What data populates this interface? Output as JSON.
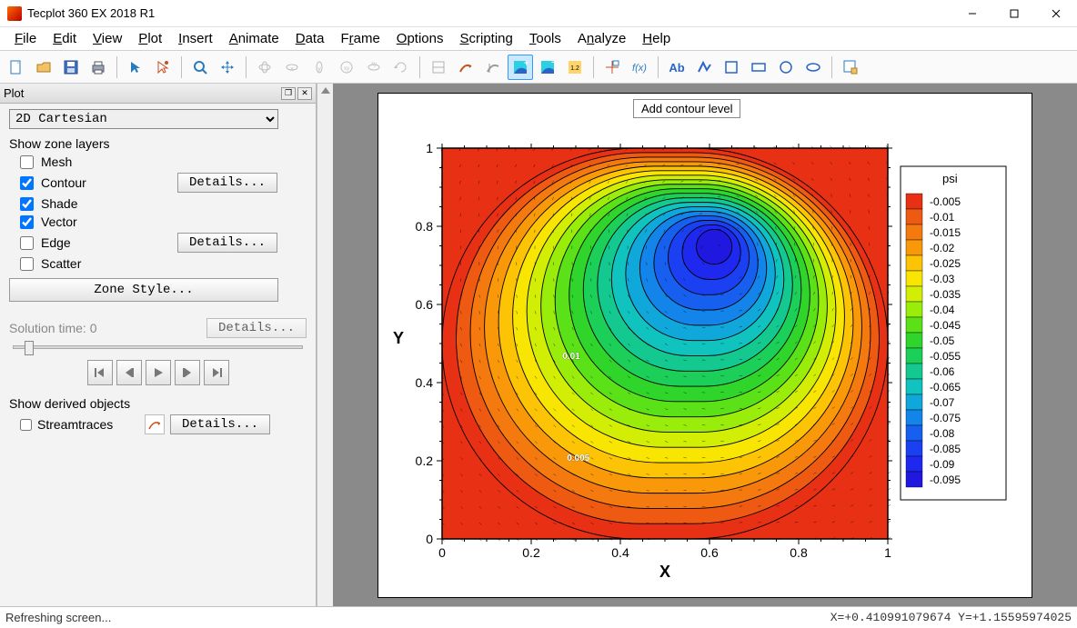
{
  "title": "Tecplot 360 EX 2018 R1",
  "menu": [
    "File",
    "Edit",
    "View",
    "Plot",
    "Insert",
    "Animate",
    "Data",
    "Frame",
    "Options",
    "Scripting",
    "Tools",
    "Analyze",
    "Help"
  ],
  "panel": {
    "title": "Plot",
    "plot_type": "2D Cartesian",
    "show_zone_layers": "Show zone layers",
    "layers": {
      "mesh": {
        "label": "Mesh",
        "checked": false
      },
      "contour": {
        "label": "Contour",
        "checked": true,
        "details": "Details..."
      },
      "shade": {
        "label": "Shade",
        "checked": true
      },
      "vector": {
        "label": "Vector",
        "checked": true
      },
      "edge": {
        "label": "Edge",
        "checked": false,
        "details": "Details..."
      },
      "scatter": {
        "label": "Scatter",
        "checked": false
      }
    },
    "zone_style": "Zone Style...",
    "solution_time_label": "Solution time:",
    "solution_time_value": "0",
    "solution_details": "Details...",
    "derived_title": "Show derived objects",
    "streamtraces": {
      "label": "Streamtraces",
      "checked": false,
      "details": "Details..."
    }
  },
  "tooltip": "Add contour level",
  "status": {
    "left": "Refreshing screen...",
    "right": "X=+0.410991079674  Y=+1.15595974025"
  },
  "chart_data": {
    "type": "contour",
    "variable": "psi",
    "xlabel": "X",
    "ylabel": "Y",
    "xlim": [
      0,
      1
    ],
    "ylim": [
      0,
      1
    ],
    "xticks": [
      0,
      0.2,
      0.4,
      0.6,
      0.8,
      1
    ],
    "yticks": [
      0,
      0.2,
      0.4,
      0.6,
      0.8,
      1
    ],
    "levels": [
      -0.005,
      -0.01,
      -0.015,
      -0.02,
      -0.025,
      -0.03,
      -0.035,
      -0.04,
      -0.045,
      -0.05,
      -0.055,
      -0.06,
      -0.065,
      -0.07,
      -0.075,
      -0.08,
      -0.085,
      -0.09,
      -0.095
    ],
    "center_approx": {
      "x": 0.62,
      "y": 0.74
    },
    "level_colormap": [
      {
        "level": -0.005,
        "color": "#e83015"
      },
      {
        "level": -0.01,
        "color": "#ef5a13"
      },
      {
        "level": -0.015,
        "color": "#f47a0f"
      },
      {
        "level": -0.02,
        "color": "#f9990a"
      },
      {
        "level": -0.025,
        "color": "#fdc405"
      },
      {
        "level": -0.03,
        "color": "#f8e602"
      },
      {
        "level": -0.035,
        "color": "#d2ee04"
      },
      {
        "level": -0.04,
        "color": "#9aec0b"
      },
      {
        "level": -0.045,
        "color": "#5be117"
      },
      {
        "level": -0.05,
        "color": "#2fd52b"
      },
      {
        "level": -0.055,
        "color": "#1ccf59"
      },
      {
        "level": -0.06,
        "color": "#14c98f"
      },
      {
        "level": -0.065,
        "color": "#10c3bf"
      },
      {
        "level": -0.07,
        "color": "#10a7db"
      },
      {
        "level": -0.075,
        "color": "#1384e9"
      },
      {
        "level": -0.08,
        "color": "#1760ef"
      },
      {
        "level": -0.085,
        "color": "#1b40f2"
      },
      {
        "level": -0.09,
        "color": "#1e28ef"
      },
      {
        "level": -0.095,
        "color": "#2118e0"
      }
    ],
    "annotations": [
      {
        "text": "0.01",
        "x": 0.27,
        "y": 0.46
      },
      {
        "text": "0.005",
        "x": 0.28,
        "y": 0.2
      }
    ]
  }
}
